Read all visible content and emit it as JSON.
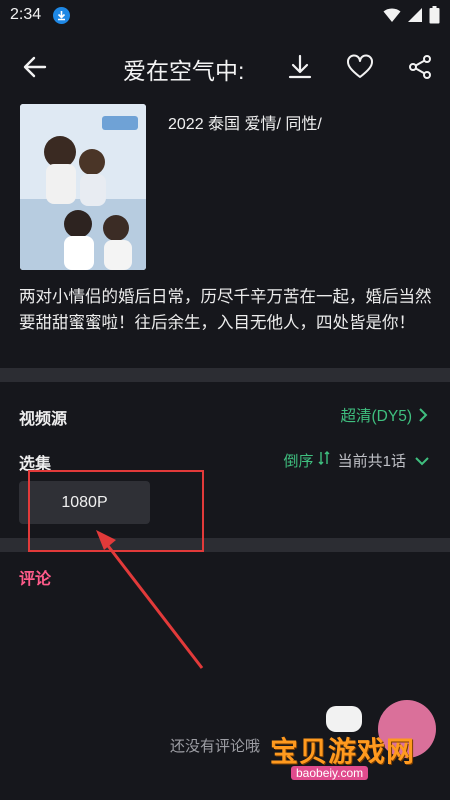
{
  "status": {
    "time": "2:34"
  },
  "header": {
    "title": "爱在空气中:"
  },
  "show": {
    "meta": "2022 泰国 爱情/ 同性/",
    "description": "两对小情侣的婚后日常，历尽千辛万苦在一起，婚后当然要甜甜蜜蜜啦！往后余生，入目无他人，四处皆是你！"
  },
  "source": {
    "label": "视频源",
    "value": "超清(DY5)"
  },
  "episodes": {
    "label": "选集",
    "order": "倒序",
    "count_text": "当前共1话",
    "items": [
      {
        "label": "1080P"
      }
    ]
  },
  "comments": {
    "label": "评论",
    "empty_text": "还没有评论哦"
  },
  "watermark": {
    "brand": "宝贝游戏网",
    "domain": "baobeiy.com"
  },
  "colors": {
    "accent_green": "#3fbf7f",
    "comment_pink": "#ff5b8a",
    "annotation_red": "#e23a3a"
  }
}
